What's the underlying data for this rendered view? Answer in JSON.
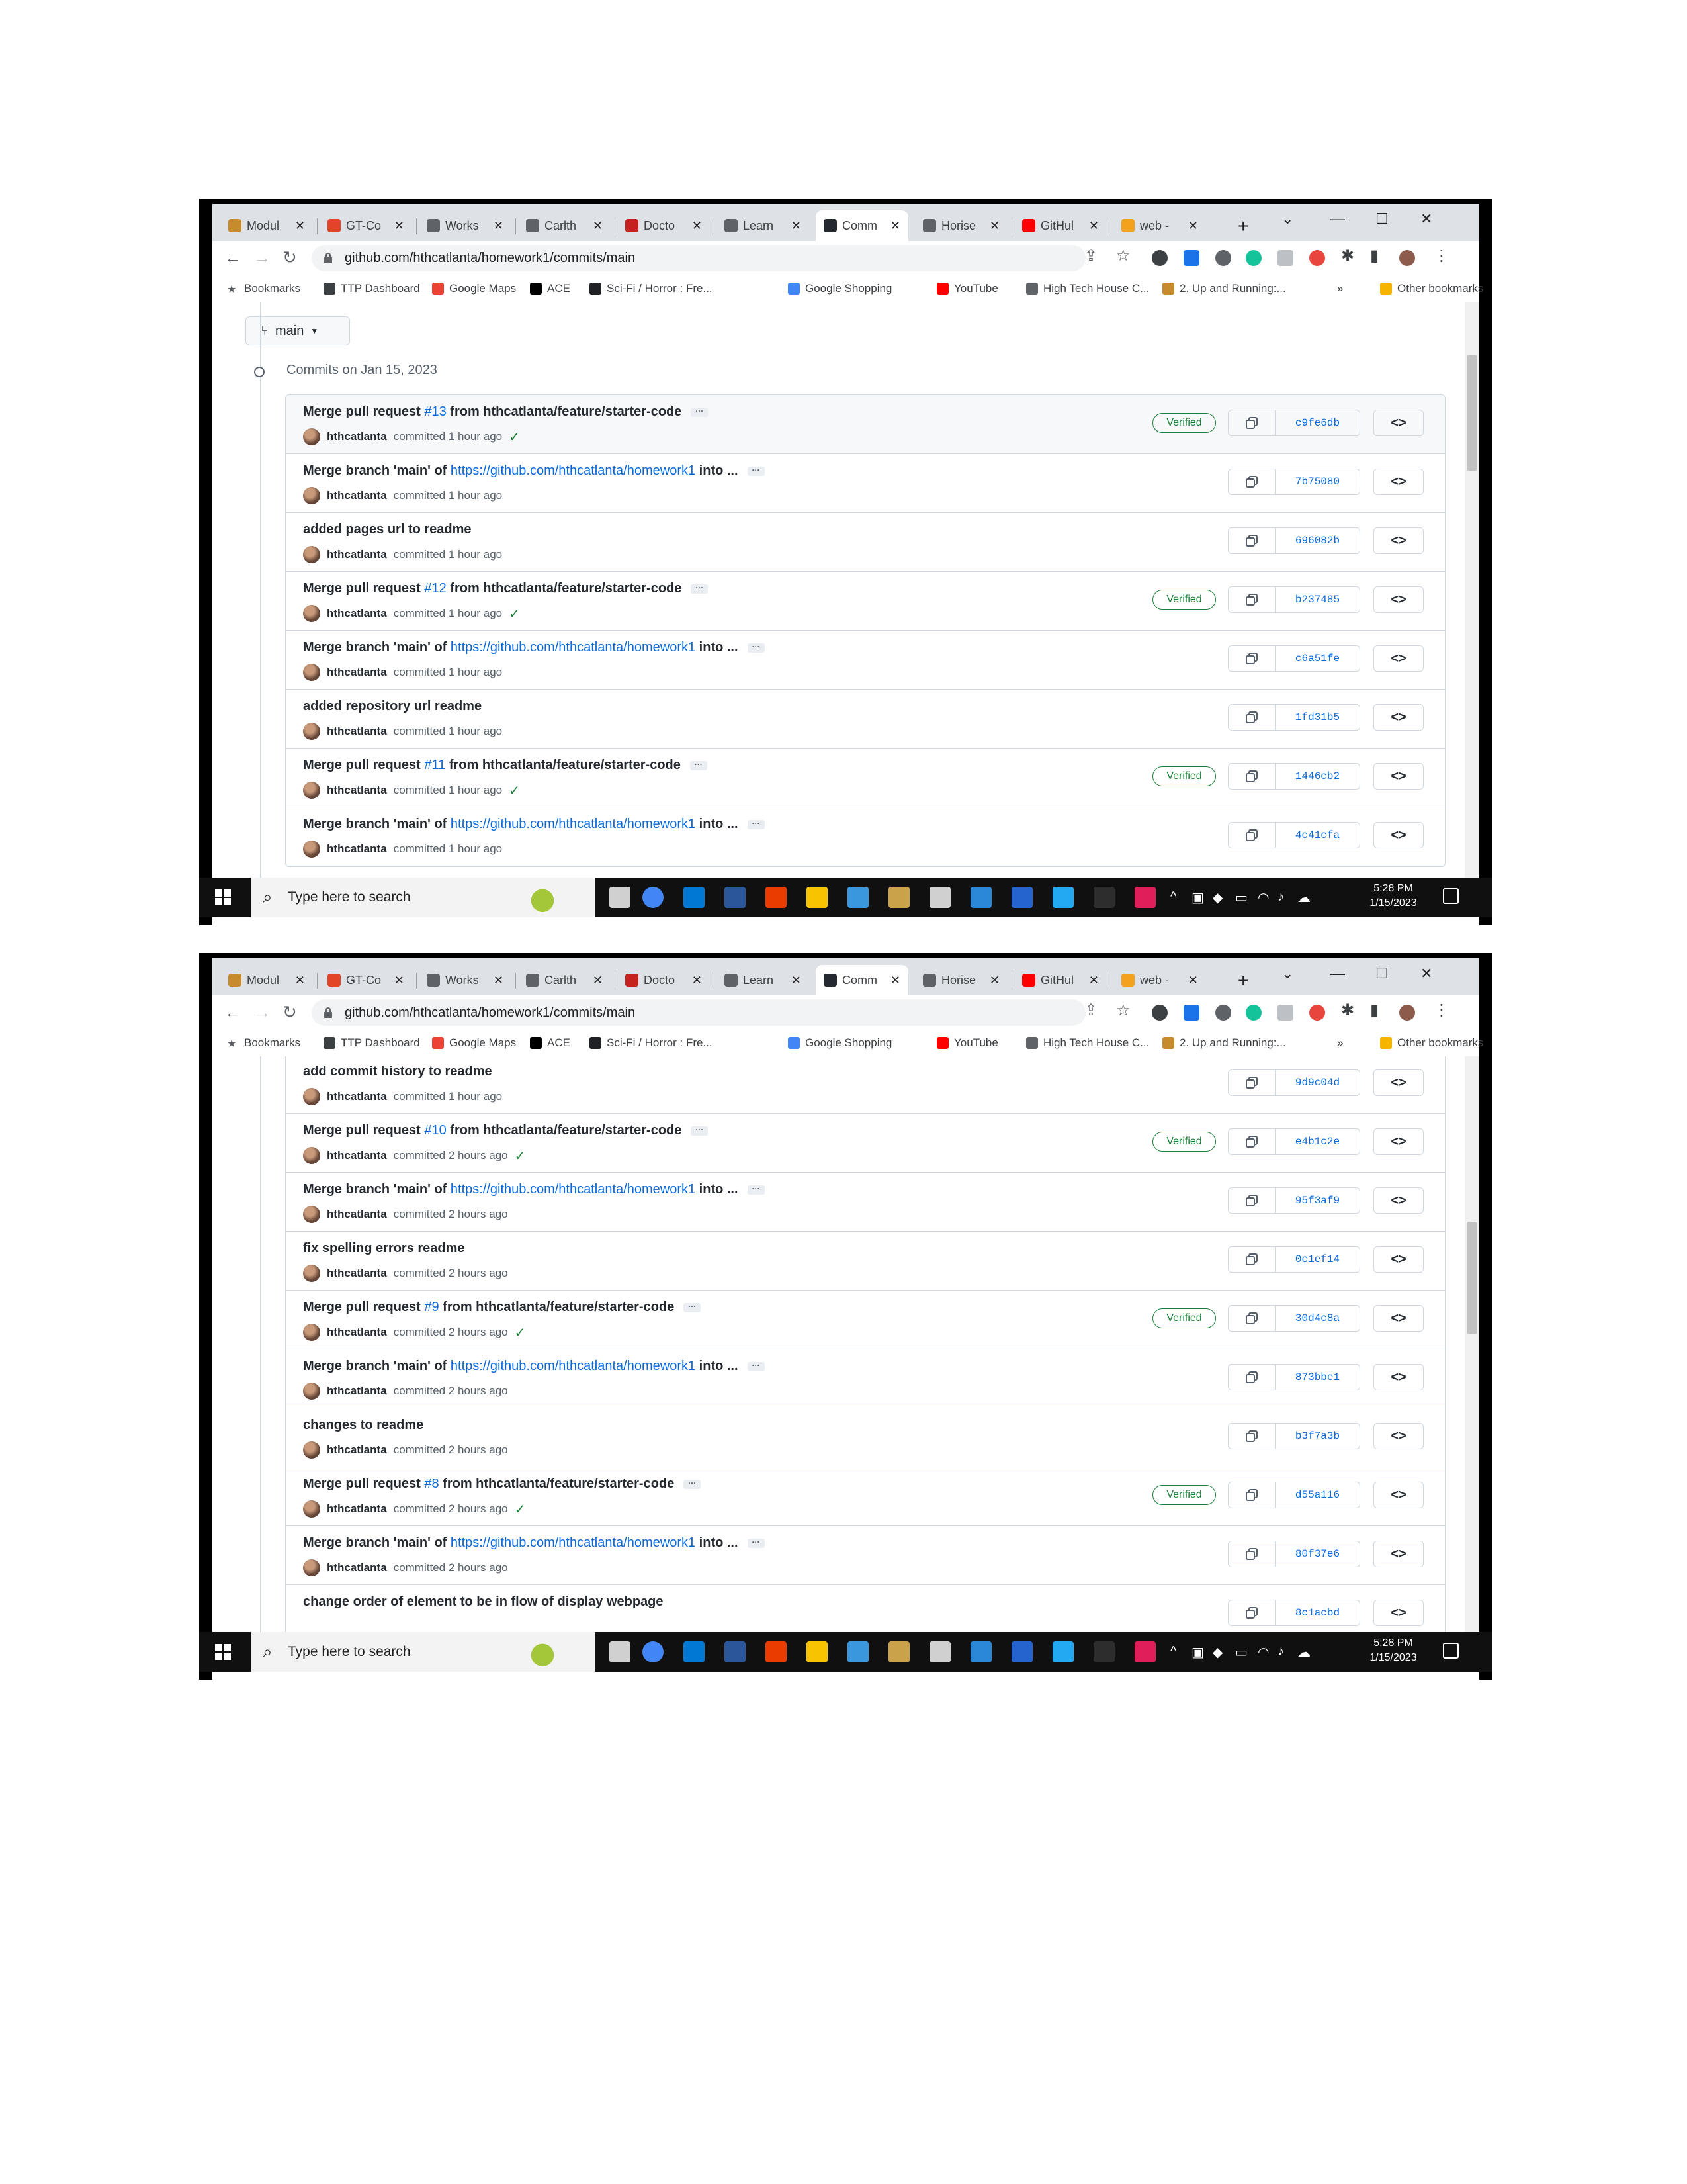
{
  "screens": [
    {
      "tabs": [
        {
          "title": "Modul",
          "icon_color": "#c68b2c"
        },
        {
          "title": "GT-Co",
          "icon_color": "#e24329"
        },
        {
          "title": "Works",
          "icon_color": "#5f6368"
        },
        {
          "title": "Carlth",
          "icon_color": "#5f6368"
        },
        {
          "title": "Docto",
          "icon_color": "#c5221f"
        },
        {
          "title": "Learn",
          "icon_color": "#5f6368"
        },
        {
          "title": "Comm",
          "icon_color": "#24292f"
        },
        {
          "title": "Horise",
          "icon_color": "#5f6368"
        },
        {
          "title": "GitHul",
          "icon_color": "#ff0000"
        },
        {
          "title": "web -",
          "icon_color": "#f4a11e"
        }
      ],
      "url": "github.com/hthcatlanta/homework1/commits/main",
      "bookmarks": [
        "Bookmarks",
        "TTP Dashboard",
        "Google Maps",
        "ACE",
        "Sci-Fi / Horror : Fre...",
        "Google Shopping",
        "YouTube",
        "High Tech House C...",
        "2. Up and Running:...",
        "Other bookmarks"
      ],
      "branch": "main",
      "commits_heading": "Commits on Jan 15, 2023",
      "commits": [
        {
          "title_pre": "Merge pull request ",
          "link": "#13",
          "title_post": " from hthcatlanta/feature/starter-code",
          "dots": true,
          "author": "hthcatlanta",
          "when": "committed 1 hour ago",
          "check": true,
          "verified": "Verified",
          "sha": "c9fe6db"
        },
        {
          "title_pre": "Merge branch 'main' of ",
          "link": "https://github.com/hthcatlanta/homework1",
          "title_post": " into ...",
          "dots": true,
          "author": "hthcatlanta",
          "when": "committed 1 hour ago",
          "check": false,
          "verified": "",
          "sha": "7b75080"
        },
        {
          "title_pre": "added pages url to readme",
          "link": "",
          "title_post": "",
          "dots": false,
          "author": "hthcatlanta",
          "when": "committed 1 hour ago",
          "check": false,
          "verified": "",
          "sha": "696082b"
        },
        {
          "title_pre": "Merge pull request ",
          "link": "#12",
          "title_post": " from hthcatlanta/feature/starter-code",
          "dots": true,
          "author": "hthcatlanta",
          "when": "committed 1 hour ago",
          "check": true,
          "verified": "Verified",
          "sha": "b237485"
        },
        {
          "title_pre": "Merge branch 'main' of ",
          "link": "https://github.com/hthcatlanta/homework1",
          "title_post": " into ...",
          "dots": true,
          "author": "hthcatlanta",
          "when": "committed 1 hour ago",
          "check": false,
          "verified": "",
          "sha": "c6a51fe"
        },
        {
          "title_pre": "added repository url readme",
          "link": "",
          "title_post": "",
          "dots": false,
          "author": "hthcatlanta",
          "when": "committed 1 hour ago",
          "check": false,
          "verified": "",
          "sha": "1fd31b5"
        },
        {
          "title_pre": "Merge pull request ",
          "link": "#11",
          "title_post": " from hthcatlanta/feature/starter-code",
          "dots": true,
          "author": "hthcatlanta",
          "when": "committed 1 hour ago",
          "check": true,
          "verified": "Verified",
          "sha": "1446cb2"
        },
        {
          "title_pre": "Merge branch 'main' of ",
          "link": "https://github.com/hthcatlanta/homework1",
          "title_post": " into ...",
          "dots": true,
          "author": "hthcatlanta",
          "when": "committed 1 hour ago",
          "check": false,
          "verified": "",
          "sha": "4c41cfa"
        }
      ],
      "taskbar": {
        "search": "Type here to search",
        "time": "5:28 PM",
        "date": "1/15/2023"
      }
    },
    {
      "commits": [
        {
          "title_pre": "add commit history to readme",
          "link": "",
          "title_post": "",
          "dots": false,
          "author": "hthcatlanta",
          "when": "committed 1 hour ago",
          "check": false,
          "verified": "",
          "sha": "9d9c04d"
        },
        {
          "title_pre": "Merge pull request ",
          "link": "#10",
          "title_post": " from hthcatlanta/feature/starter-code",
          "dots": true,
          "author": "hthcatlanta",
          "when": "committed 2 hours ago",
          "check": true,
          "verified": "Verified",
          "sha": "e4b1c2e"
        },
        {
          "title_pre": "Merge branch 'main' of ",
          "link": "https://github.com/hthcatlanta/homework1",
          "title_post": " into ...",
          "dots": true,
          "author": "hthcatlanta",
          "when": "committed 2 hours ago",
          "check": false,
          "verified": "",
          "sha": "95f3af9"
        },
        {
          "title_pre": "fix spelling errors readme",
          "link": "",
          "title_post": "",
          "dots": false,
          "author": "hthcatlanta",
          "when": "committed 2 hours ago",
          "check": false,
          "verified": "",
          "sha": "0c1ef14"
        },
        {
          "title_pre": "Merge pull request ",
          "link": "#9",
          "title_post": " from hthcatlanta/feature/starter-code",
          "dots": true,
          "author": "hthcatlanta",
          "when": "committed 2 hours ago",
          "check": true,
          "verified": "Verified",
          "sha": "30d4c8a"
        },
        {
          "title_pre": "Merge branch 'main' of ",
          "link": "https://github.com/hthcatlanta/homework1",
          "title_post": " into ...",
          "dots": true,
          "author": "hthcatlanta",
          "when": "committed 2 hours ago",
          "check": false,
          "verified": "",
          "sha": "873bbe1"
        },
        {
          "title_pre": "changes to readme",
          "link": "",
          "title_post": "",
          "dots": false,
          "author": "hthcatlanta",
          "when": "committed 2 hours ago",
          "check": false,
          "verified": "",
          "sha": "b3f7a3b"
        },
        {
          "title_pre": "Merge pull request ",
          "link": "#8",
          "title_post": " from hthcatlanta/feature/starter-code",
          "dots": true,
          "author": "hthcatlanta",
          "when": "committed 2 hours ago",
          "check": true,
          "verified": "Verified",
          "sha": "d55a116"
        },
        {
          "title_pre": "Merge branch 'main' of ",
          "link": "https://github.com/hthcatlanta/homework1",
          "title_post": " into ...",
          "dots": true,
          "author": "hthcatlanta",
          "when": "committed 2 hours ago",
          "check": false,
          "verified": "",
          "sha": "80f37e6"
        },
        {
          "title_pre": "change order of element to be in flow of display webpage",
          "link": "",
          "title_post": "",
          "dots": false,
          "author": "",
          "when": "",
          "check": false,
          "verified": "",
          "sha": "8c1acbd"
        }
      ]
    }
  ]
}
